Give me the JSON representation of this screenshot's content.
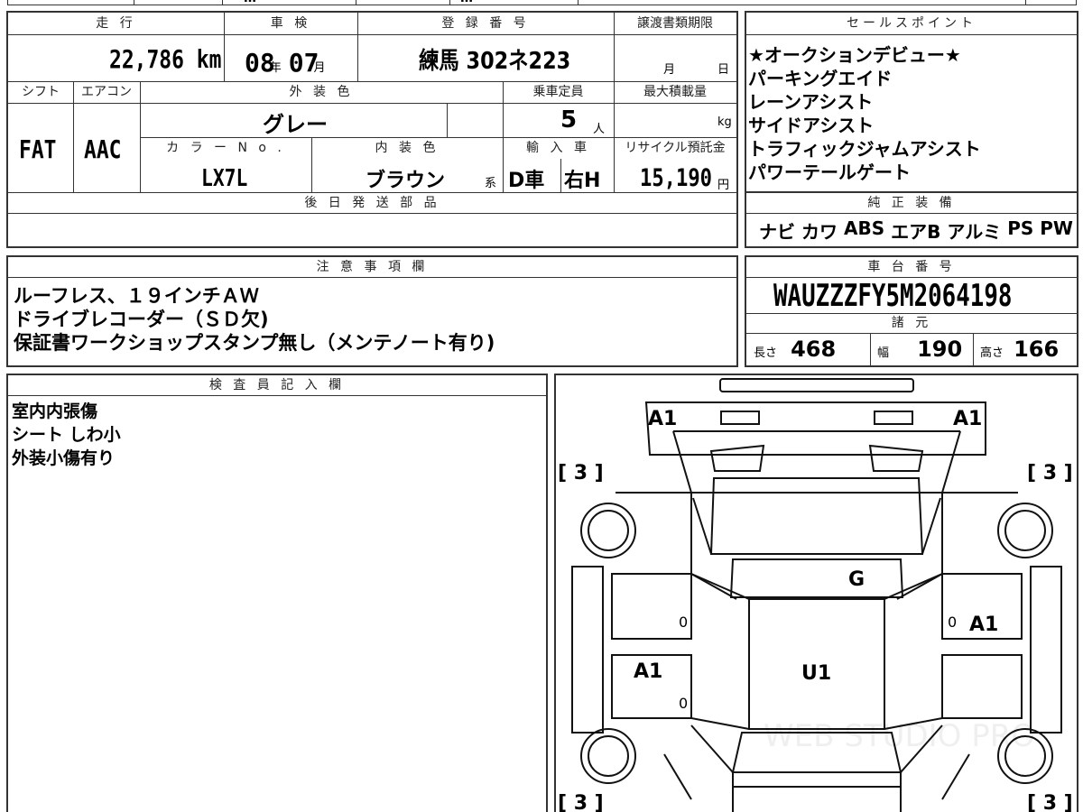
{
  "top_strip": {
    "fragment_center": "…",
    "fragment_right": "…"
  },
  "main_table": {
    "labels": {
      "mileage": "走 行",
      "inspection": "車 検",
      "registration": "登 録 番 号",
      "transfer_deadline": "譲渡書類期限",
      "shift": "シフト",
      "aircon": "エアコン",
      "exterior_color": "外 装 色",
      "capacity": "乗車定員",
      "max_load": "最大積載量",
      "color_no": "カ ラ ー N o .",
      "interior_color": "内 装 色",
      "import": "輸 入 車",
      "recycle_fee": "リサイクル預託金",
      "delivery_parts": "後 日 発 送 部 品"
    },
    "values": {
      "mileage": "22,786 km",
      "inspection_year": "08",
      "inspection_year_unit": "年",
      "inspection_month": "07",
      "inspection_month_unit": "月",
      "registration": "練馬 302ネ223",
      "deadline_month_unit": "月",
      "deadline_day_unit": "日",
      "shift": "FAT",
      "aircon": "AAC",
      "exterior_color": "グレー",
      "capacity": "5",
      "capacity_unit": "人",
      "max_load_unit": "kg",
      "color_no": "LX7L",
      "interior_color": "ブラウン",
      "interior_suffix": "系",
      "import": "D車",
      "steering": "右H",
      "recycle_fee": "15,190",
      "recycle_unit": "円",
      "delivery_parts": ""
    }
  },
  "sales_points": {
    "title": "セールスポイント",
    "items": [
      "★オークションデビュー★",
      "パーキングエイド",
      "レーンアシスト",
      "サイドアシスト",
      "トラフィックジャムアシスト",
      "パワーテールゲート"
    ]
  },
  "equipment": {
    "title": "純 正 装 備",
    "items": [
      "ナビ",
      "カワ",
      "ABS",
      "エアB",
      "アルミ",
      "PS",
      "PW"
    ]
  },
  "notes": {
    "title": "注 意 事 項 欄",
    "lines": [
      "ルーフレス、１９インチＡＷ",
      "ドライブレコーダー（ＳＤ欠)",
      "保証書ワークショップスタンプ無し（メンテノート有り)"
    ]
  },
  "chassis": {
    "title": "車 台 番 号",
    "number": "WAUZZZFY5M2064198"
  },
  "specs": {
    "title": "諸 元",
    "length_label": "長さ",
    "length": "468",
    "width_label": "幅",
    "width": "190",
    "height_label": "高さ",
    "height": "166"
  },
  "inspector": {
    "title": "検 査 員 記 入 欄",
    "lines": [
      "室内内張傷",
      "シート しわ小",
      "外装小傷有り"
    ]
  },
  "diagram": {
    "marks": {
      "front_left": "A1",
      "front_right": "A1",
      "tire_fl": "[ 3 ]",
      "tire_fr": "[ 3 ]",
      "tire_rl": "[ 3 ]",
      "tire_rr": "[ 3 ]",
      "windshield": "G",
      "roof": "U1",
      "right_door": "A1",
      "left_door": "A1",
      "zero_1": "0",
      "zero_2": "0",
      "zero_3": "0"
    },
    "watermark": "WEB STUDIO PRO"
  }
}
